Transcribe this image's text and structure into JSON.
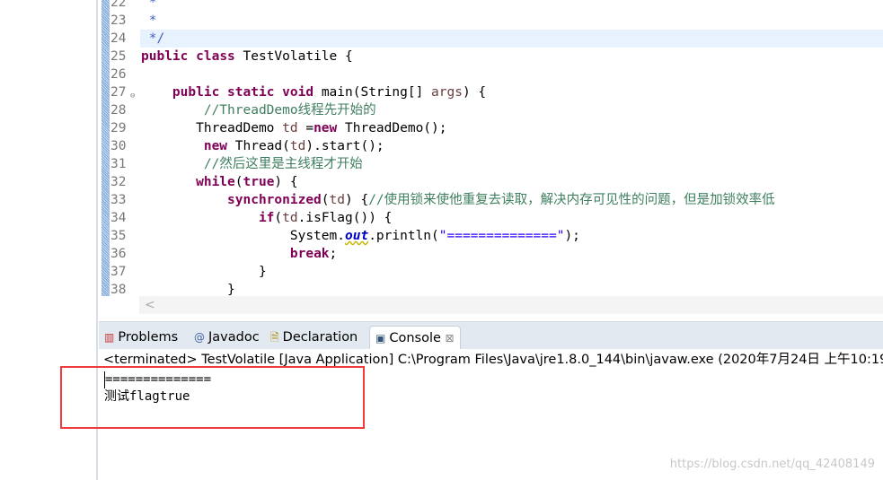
{
  "editor": {
    "lines": [
      {
        "n": "22",
        "html": " <span class=\"jd\">*</span>"
      },
      {
        "n": "23",
        "html": " <span class=\"jd\">*</span>"
      },
      {
        "n": "24",
        "html": " <span class=\"jd\">*/</span>",
        "current": true
      },
      {
        "n": "25",
        "html": "<span class=\"kw\">public</span> <span class=\"kw\">class</span> TestVolatile {"
      },
      {
        "n": "26",
        "html": ""
      },
      {
        "n": "27",
        "html": "    <span class=\"kw\">public</span> <span class=\"kw\">static</span> <span class=\"kw\">void</span> main(String[] <span class=\"var\">args</span>) {",
        "fold": true
      },
      {
        "n": "28",
        "html": "        <span class=\"cm\">//ThreadDemo线程先开始的</span>"
      },
      {
        "n": "29",
        "html": "       ThreadDemo <span class=\"var\">td</span> =<span class=\"kw\">new</span> ThreadDemo();"
      },
      {
        "n": "30",
        "html": "        <span class=\"kw\">new</span> Thread(<span class=\"var\">td</span>).start();"
      },
      {
        "n": "31",
        "html": "        <span class=\"cm\">//然后这里是主线程才开始</span>"
      },
      {
        "n": "32",
        "html": "       <span class=\"kw\">while</span>(<span class=\"kw\">true</span>) {"
      },
      {
        "n": "33",
        "html": "           <span class=\"kw\">synchronized</span>(<span class=\"var\">td</span>) {<span class=\"cm\">//使用锁来使他重复去读取，解决内存可见性的问题，但是加锁效率低</span>"
      },
      {
        "n": "34",
        "html": "               <span class=\"kw\">if</span>(<span class=\"var\">td</span>.isFlag()) {"
      },
      {
        "n": "35",
        "html": "                   System.<span class=\"fld\">out</span>.println(<span class=\"str\">\"==============\"</span>);"
      },
      {
        "n": "36",
        "html": "                   <span class=\"kw\">break</span>;"
      },
      {
        "n": "37",
        "html": "               }"
      },
      {
        "n": "38",
        "html": "           }"
      }
    ],
    "scroll_left": "<"
  },
  "tabs": [
    {
      "label": "Problems",
      "icon": "problems-icon"
    },
    {
      "label": "Javadoc",
      "icon": "javadoc-icon"
    },
    {
      "label": "Declaration",
      "icon": "declaration-icon"
    },
    {
      "label": "Console",
      "icon": "console-icon",
      "active": true,
      "close": "⊠"
    }
  ],
  "console": {
    "header": "<terminated> TestVolatile [Java Application] C:\\Program Files\\Java\\jre1.8.0_144\\bin\\javaw.exe (2020年7月24日 上午10:19",
    "output": [
      "==============",
      "测试flagtrue"
    ]
  },
  "watermark": "https://blog.csdn.net/qq_42408149"
}
